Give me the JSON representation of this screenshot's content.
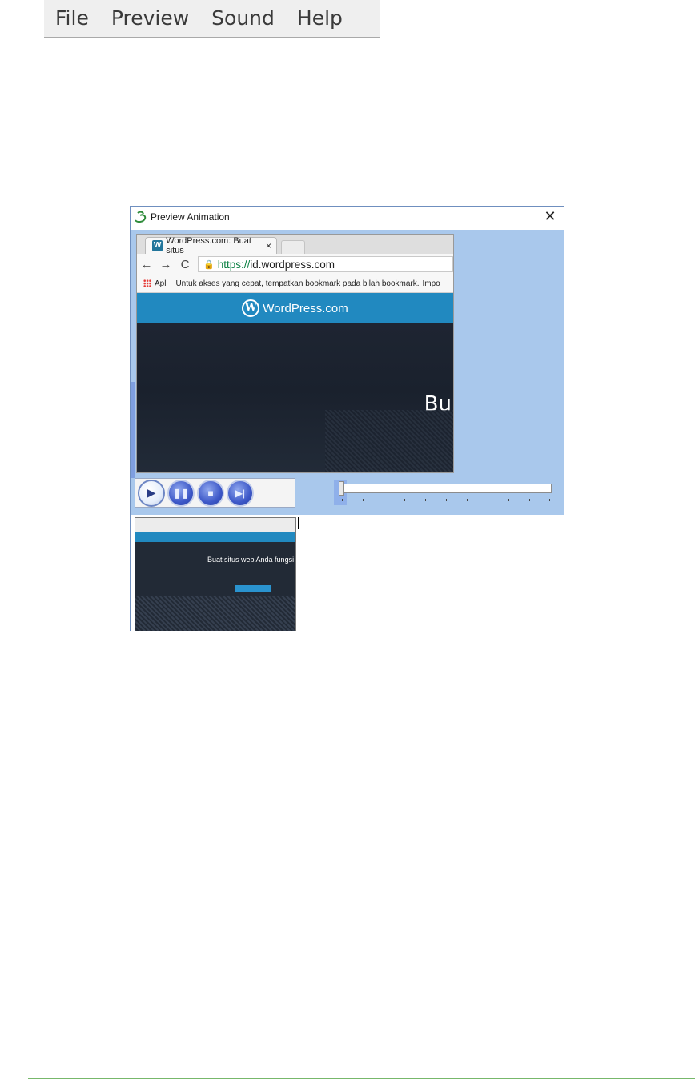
{
  "menu": {
    "items": [
      {
        "label": "File"
      },
      {
        "label": "Preview"
      },
      {
        "label": "Sound"
      },
      {
        "label": "Help"
      }
    ]
  },
  "window": {
    "title": "Preview Animation",
    "close_glyph": "✕",
    "icon": "app-logo-icon"
  },
  "browser": {
    "tab_title": "WordPress.com: Buat situs",
    "tab_close": "×",
    "back_glyph": "←",
    "forward_glyph": "→",
    "reload_glyph": "C",
    "url_scheme": "https://",
    "url_host": "id.wordpress.com",
    "apps_label": "Apl",
    "bookmark_hint": "Untuk akses yang cepat, tempatkan bookmark pada bilah bookmark.",
    "bookmark_import": "Impo",
    "brand": "WordPress.com",
    "hero_text": "Bu"
  },
  "controls": {
    "play": "▶",
    "pause": "❚❚",
    "stop": "■",
    "next": "▶|"
  },
  "thumbnail": {
    "hero_text": "Buat situs web Anda fungsi ste"
  }
}
